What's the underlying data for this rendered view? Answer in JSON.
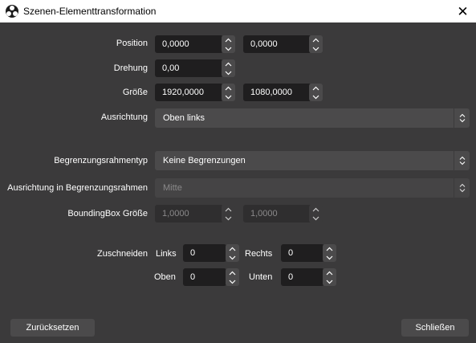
{
  "window": {
    "title": "Szenen-Elementtransformation",
    "close_glyph": "✕"
  },
  "position": {
    "label": "Position",
    "x": "0,0000",
    "y": "0,0000"
  },
  "rotation": {
    "label": "Drehung",
    "value": "0,00"
  },
  "size": {
    "label": "Größe",
    "width": "1920,0000",
    "height": "1080,0000"
  },
  "alignment": {
    "label": "Ausrichtung",
    "value": "Oben links"
  },
  "bounds_type": {
    "label": "Begrenzungsrahmentyp",
    "value": "Keine Begrenzungen"
  },
  "bounds_alignment": {
    "label": "Ausrichtung in Begrenzungsrahmen",
    "value": "Mitte"
  },
  "bounding_box": {
    "label": "BoundingBox Größe",
    "width": "1,0000",
    "height": "1,0000"
  },
  "crop": {
    "label": "Zuschneiden",
    "left_label": "Links",
    "left": "0",
    "right_label": "Rechts",
    "right": "0",
    "top_label": "Oben",
    "top": "0",
    "bottom_label": "Unten",
    "bottom": "0"
  },
  "buttons": {
    "reset": "Zurücksetzen",
    "close": "Schließen"
  },
  "colors": {
    "background": "#3b3a3b",
    "field": "#1f1e1f",
    "control": "#4b4a4b"
  }
}
